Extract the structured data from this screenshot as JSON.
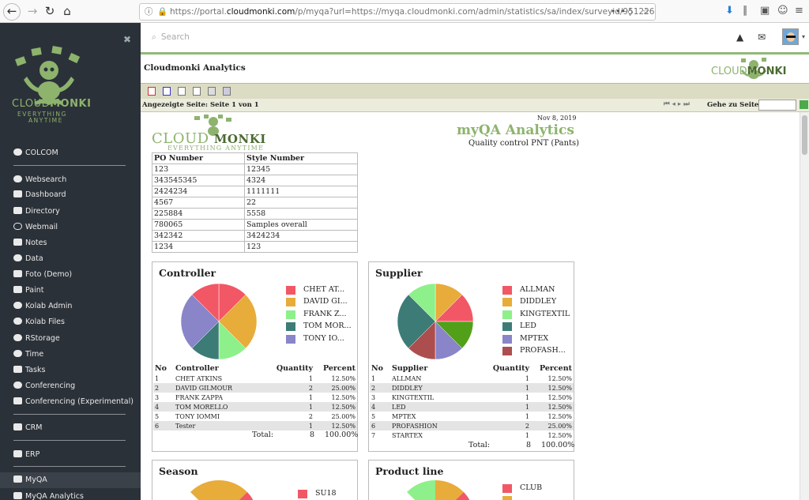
{
  "browser": {
    "url_prefix": "https://portal.",
    "url_domain": "cloudmonki.com",
    "url_rest": "/p/myqa?url=https://myqa.cloudmonki.com/admin/statistics/sa/index/surveyid/951226",
    "ellipsis": "•••"
  },
  "sidebar": {
    "logo_text_a": "CLOUD",
    "logo_text_b": "MONKI",
    "tagline_1": "EVERYTHING",
    "tagline_2": "ANYTIME",
    "items": [
      "COLCOM",
      "Websearch",
      "Dashboard",
      "Directory",
      "Webmail",
      "Notes",
      "Data",
      "Foto (Demo)",
      "Paint",
      "Kolab Admin",
      "Kolab Files",
      "RStorage",
      "Time",
      "Tasks",
      "Conferencing",
      "Conferencing (Experimental)",
      "CRM",
      "ERP",
      "MyQA",
      "MyQA Analytics"
    ]
  },
  "topbar": {
    "search_placeholder": "Search"
  },
  "app": {
    "title": "Cloudmonki Analytics",
    "logo_a": "CLOUD",
    "logo_b": "MONKI"
  },
  "pager": {
    "label": "Angezeigte Seite: Seite  1  von  1",
    "goto": "Gehe zu Seite:"
  },
  "report": {
    "date": "Nov 8, 2019",
    "title": "myQA Analytics",
    "subtitle": "Quality control PNT (Pants)",
    "logo_a": "CLOUD",
    "logo_b": "MONKI",
    "tagline": "EVERYTHING ANYTIME",
    "po_headers": [
      "PO Number",
      "Style Number"
    ],
    "po_rows": [
      [
        "123",
        "12345"
      ],
      [
        "343545345",
        "4324"
      ],
      [
        "2424234",
        "1111111"
      ],
      [
        "4567",
        "22"
      ],
      [
        "225884",
        "5558"
      ],
      [
        "780065",
        "Samples overall"
      ],
      [
        "342342",
        "3424234"
      ],
      [
        "1234",
        "123"
      ]
    ]
  },
  "colors": {
    "red": "#f25766",
    "orange": "#e8ac3a",
    "lightgreen": "#8ef08a",
    "teal": "#3d7c76",
    "purple": "#8985c8",
    "brick": "#ad4e4e",
    "green": "#52a01a",
    "brand": "#8db36d"
  },
  "controller": {
    "title": "Controller",
    "legend": [
      "CHET AT...",
      "DAVID GI...",
      "FRANK Z...",
      "TOM MOR...",
      "TONY IO..."
    ],
    "headers": [
      "No",
      "Controller",
      "Quantity",
      "Percent"
    ],
    "rows": [
      [
        "1",
        "CHET ATKINS",
        "1",
        "12.50%"
      ],
      [
        "2",
        "DAVID GILMOUR",
        "2",
        "25.00%"
      ],
      [
        "3",
        "FRANK ZAPPA",
        "1",
        "12.50%"
      ],
      [
        "4",
        "TOM MORELLO",
        "1",
        "12.50%"
      ],
      [
        "5",
        "TONY IOMMI",
        "2",
        "25.00%"
      ],
      [
        "6",
        "Tester",
        "1",
        "12.50%"
      ]
    ],
    "total_label": "Total:",
    "total_qty": "8",
    "total_pct": "100.00%"
  },
  "supplier": {
    "title": "Supplier",
    "legend": [
      "ALLMAN",
      "DIDDLEY",
      "KINGTEXTIL",
      "LED",
      "MPTEX",
      "PROFASH..."
    ],
    "headers": [
      "No",
      "Supplier",
      "Quantity",
      "Percent"
    ],
    "rows": [
      [
        "1",
        "ALLMAN",
        "1",
        "12.50%"
      ],
      [
        "2",
        "DIDDLEY",
        "1",
        "12.50%"
      ],
      [
        "3",
        "KINGTEXTIL",
        "1",
        "12.50%"
      ],
      [
        "4",
        "LED",
        "1",
        "12.50%"
      ],
      [
        "5",
        "MPTEX",
        "1",
        "12.50%"
      ],
      [
        "6",
        "PROFASHION",
        "2",
        "25.00%"
      ],
      [
        "7",
        "STARTEX",
        "1",
        "12.50%"
      ]
    ],
    "total_label": "Total:",
    "total_qty": "8",
    "total_pct": "100.00%"
  },
  "season": {
    "title": "Season",
    "legend": [
      "SU18"
    ]
  },
  "productline": {
    "title": "Product line",
    "legend": [
      "CLUB"
    ]
  },
  "chart_data": [
    {
      "type": "pie",
      "title": "Controller",
      "categories": [
        "CHET ATKINS",
        "DAVID GILMOUR",
        "FRANK ZAPPA",
        "TOM MORELLO",
        "TONY IOMMI",
        "Tester"
      ],
      "values": [
        1,
        2,
        1,
        1,
        2,
        1
      ],
      "colors": [
        "#f25766",
        "#e8ac3a",
        "#8ef08a",
        "#3d7c76",
        "#8985c8",
        "#f25766"
      ]
    },
    {
      "type": "pie",
      "title": "Supplier",
      "categories": [
        "ALLMAN",
        "DIDDLEY",
        "KINGTEXTIL",
        "LED",
        "MPTEX",
        "PROFASHION",
        "STARTEX"
      ],
      "values": [
        1,
        1,
        1,
        1,
        1,
        2,
        1
      ],
      "colors": [
        "#e8ac3a",
        "#f25766",
        "#52a01a",
        "#8985c8",
        "#ad4e4e",
        "#3d7c76",
        "#8ef08a"
      ]
    }
  ]
}
